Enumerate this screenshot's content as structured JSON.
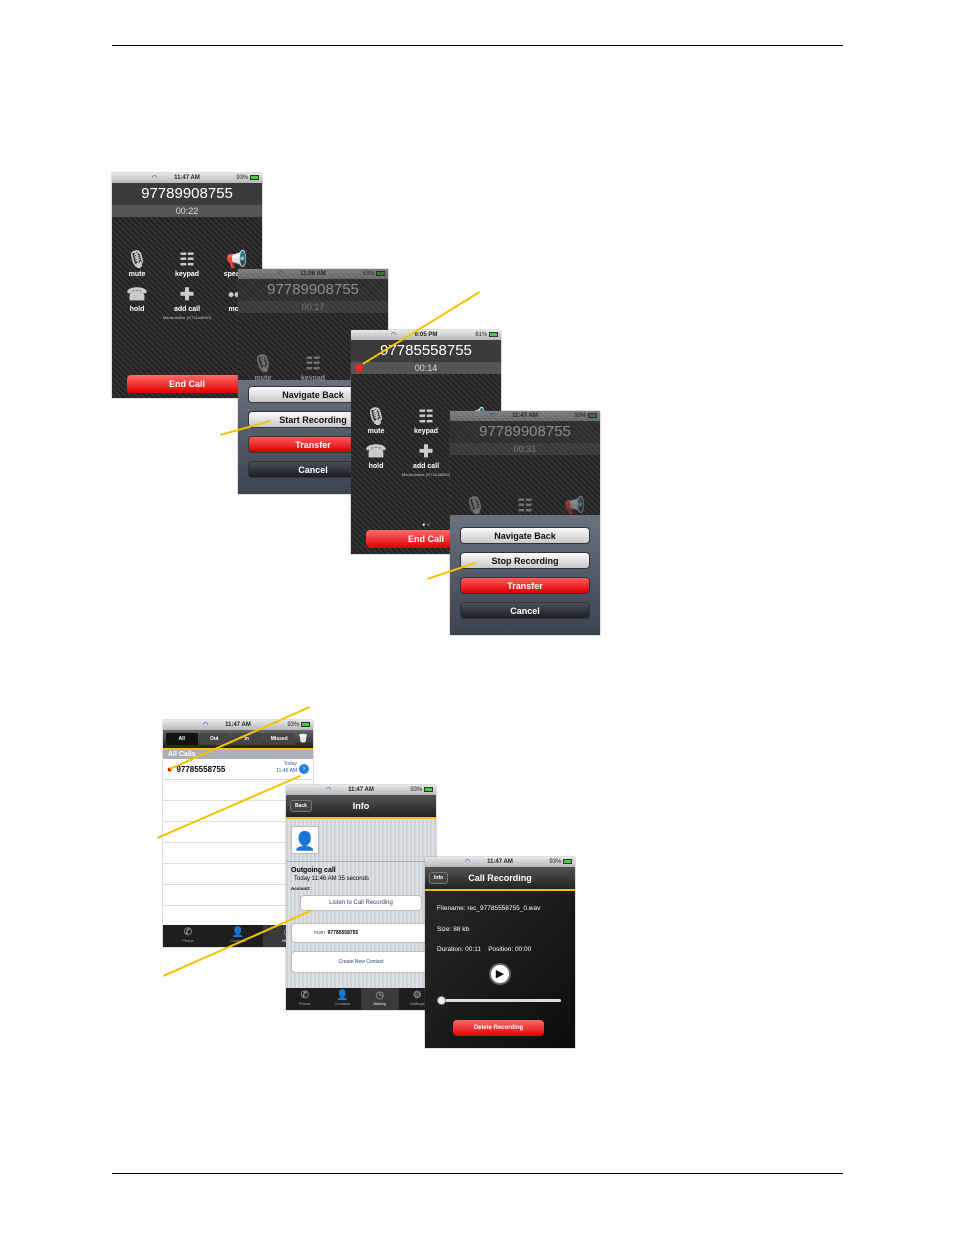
{
  "status": {
    "time": "11:47 AM",
    "time_b": "11:06 AM",
    "time_c": "6:05 PM",
    "battery": "93%",
    "battery_c": "61%"
  },
  "call": {
    "number_a": "97789908755",
    "timer_a": "00:22",
    "timer_b": "00:17",
    "number_c": "97785558755",
    "timer_c": "00:14",
    "timer_d": "00:31",
    "buttons": [
      "mute",
      "keypad",
      "speaker",
      "hold",
      "add call",
      "more"
    ],
    "media": "Media Active (G711u/8000)",
    "end_call": "End Call"
  },
  "sheet": {
    "navigate_back": "Navigate Back",
    "start_recording": "Start Recording",
    "stop_recording": "Stop Recording",
    "transfer": "Transfer",
    "cancel": "Cancel"
  },
  "history": {
    "segments": [
      "All",
      "Out",
      "In",
      "Missed"
    ],
    "header": "All Calls",
    "entry_number": "97785558755",
    "entry_day": "Today",
    "entry_time": "11:46 AM",
    "tabs": [
      "Phone",
      "Contacts",
      "History",
      "Settings"
    ]
  },
  "info": {
    "back": "Back",
    "title": "Info",
    "call_type": "Outgoing call",
    "call_detail": "Today 11:46 AM   35 seconds",
    "account": "Account:",
    "listen": "Listen to Call Recording",
    "main_label": "main",
    "main_number": "97785558755",
    "create": "Create New Contact"
  },
  "recording": {
    "back": "Info",
    "title": "Call Recording",
    "filename": "Filename: rec_97785558755_0.wav",
    "size": "Size: 88 kb",
    "duration": "Duration: 00:11",
    "position": "Position: 00:00",
    "delete": "Delete Recording",
    "progress": 0
  }
}
